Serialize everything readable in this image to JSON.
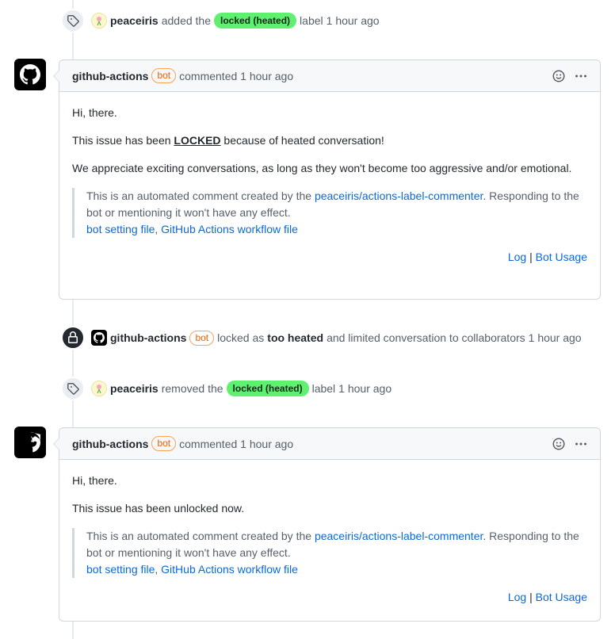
{
  "events": [
    {
      "actor": "peaceiris",
      "action": "added the",
      "label": "locked (heated)",
      "suffix": "label",
      "time": "1 hour ago"
    },
    {
      "actor": "github-actions",
      "bot_tag": "bot",
      "action": "locked as",
      "reason": "too heated",
      "suffix": "and limited conversation to collaborators",
      "time": "1 hour ago"
    },
    {
      "actor": "peaceiris",
      "action": "removed the",
      "label": "locked (heated)",
      "suffix": "label",
      "time": "1 hour ago"
    }
  ],
  "comments": [
    {
      "author": "github-actions",
      "bot_tag": "bot",
      "meta": "commented 1 hour ago",
      "greeting": "Hi, there.",
      "line_pre": "This issue has been ",
      "line_strong": "LOCKED",
      "line_post": " because of heated conversation!",
      "paragraph": "We appreciate exciting conversations, as long as they won't become too aggressive and/or emotional.",
      "quote_pre": "This is an automated comment created by the ",
      "quote_link": "peaceiris/actions-label-commenter",
      "quote_post": ". Responding to the bot or mentioning it won't have any effect.",
      "link_setting": "bot setting file",
      "link_sep": ", ",
      "link_workflow": "GitHub Actions workflow file",
      "footer_log": "Log",
      "footer_sep": " | ",
      "footer_usage": "Bot Usage"
    },
    {
      "author": "github-actions",
      "bot_tag": "bot",
      "meta": "commented 1 hour ago",
      "greeting": "Hi, there.",
      "line": "This issue has been unlocked now.",
      "quote_pre": "This is an automated comment created by the ",
      "quote_link": "peaceiris/actions-label-commenter",
      "quote_post": ". Responding to the bot or mentioning it won't have any effect.",
      "link_setting": "bot setting file",
      "link_sep": ", ",
      "link_workflow": "GitHub Actions workflow file",
      "footer_log": "Log",
      "footer_sep": " | ",
      "footer_usage": "Bot Usage"
    }
  ],
  "colors": {
    "label_bg": "#5ef06f",
    "bot_tag": "#e36209",
    "link": "#0969da"
  }
}
